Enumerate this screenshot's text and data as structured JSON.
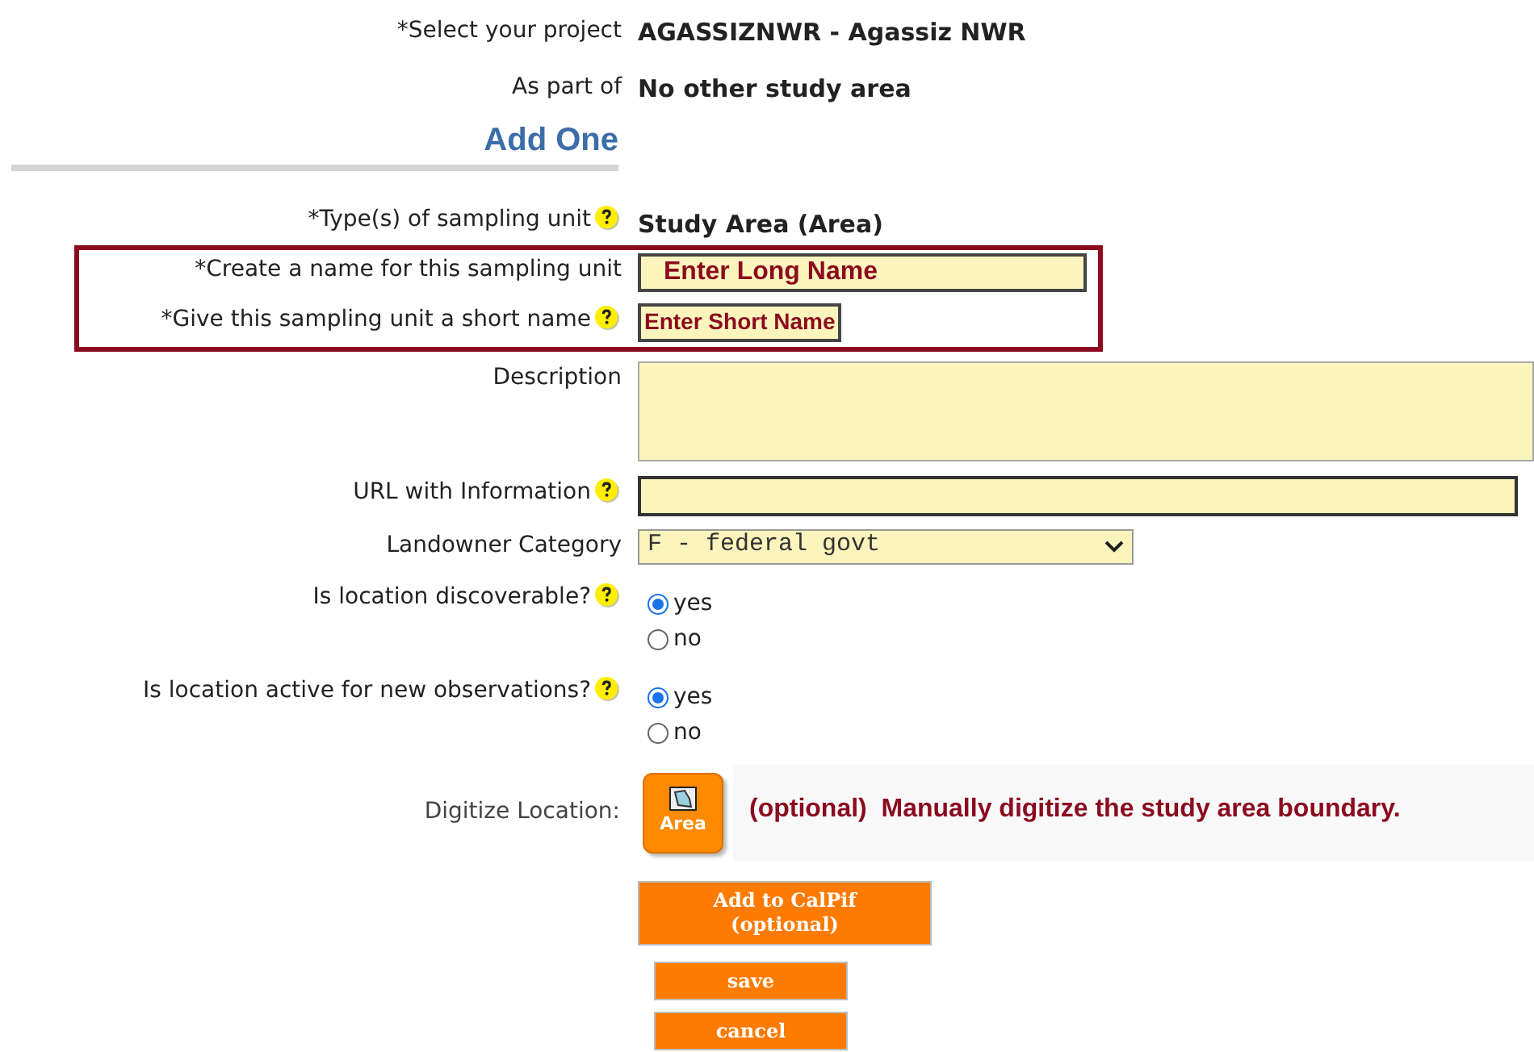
{
  "project": {
    "label": "*Select your project",
    "value": "AGASSIZNWR - Agassiz NWR"
  },
  "part_of": {
    "label": "As part of",
    "value": "No other study area"
  },
  "section_title": "Add One",
  "type_row": {
    "label": "*Type(s) of sampling unit",
    "help": true,
    "value": "Study Area (Area)"
  },
  "highlighted_fields": [
    {
      "label": "*Create a name for this sampling unit",
      "help": false,
      "kind": "long",
      "value": "Enter Long Name"
    },
    {
      "label": "*Give this sampling unit a short name",
      "help": true,
      "kind": "short",
      "value": "Enter Short Name"
    }
  ],
  "fields": [
    {
      "kind": "textarea",
      "label": "Description",
      "help": false
    },
    {
      "kind": "input",
      "label": "URL with Information",
      "help": true
    },
    {
      "kind": "select",
      "label": "Landowner Category",
      "help": false,
      "value": "F - federal govt"
    },
    {
      "kind": "radio",
      "label": "Is location discoverable?",
      "help": true,
      "options": [
        {
          "label": "yes",
          "selected": true
        },
        {
          "label": "no",
          "selected": false
        }
      ]
    },
    {
      "kind": "radio",
      "label": "Is location active for new observations?",
      "help": true,
      "options": [
        {
          "label": "yes",
          "selected": true
        },
        {
          "label": "no",
          "selected": false
        }
      ]
    }
  ],
  "digitize": {
    "label": "Digitize Location:",
    "button": "Area",
    "note_prefix": "(optional)",
    "note": "Manually digitize the study area boundary."
  },
  "calpif_button": [
    "Add to CalPif",
    "(optional)"
  ],
  "buttons": [
    "save",
    "cancel"
  ]
}
